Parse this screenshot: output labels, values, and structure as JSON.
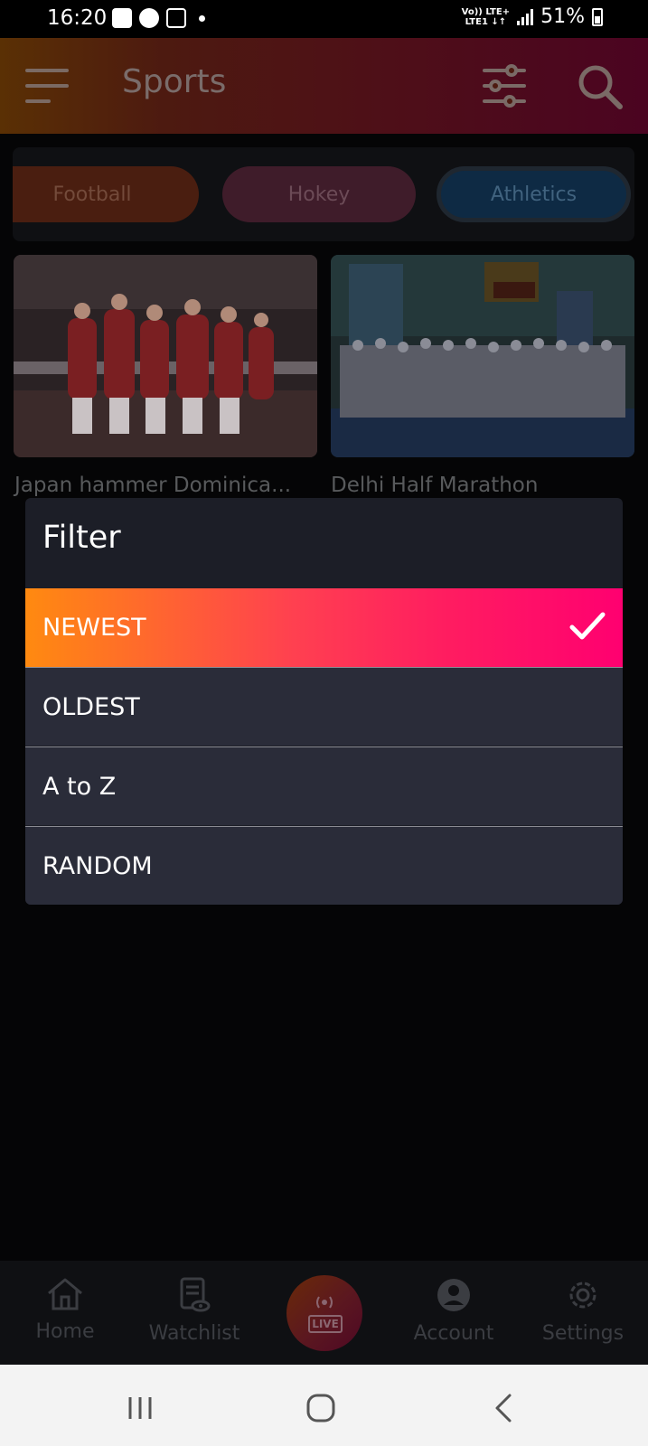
{
  "status_bar": {
    "time": "16:20",
    "network_line1": "Vo)) LTE+",
    "network_line2": "LTE1 ↓↑",
    "battery": "51%"
  },
  "app_bar": {
    "title": "Sports",
    "menu_icon": "hamburger-menu-icon",
    "filter_icon": "sliders-icon",
    "search_icon": "search-icon"
  },
  "categories": [
    {
      "label": "Football"
    },
    {
      "label": "Hokey"
    },
    {
      "label": "Athletics"
    }
  ],
  "news": [
    {
      "title": "Japan hammer Dominica...",
      "image": "volleyball-team-photo"
    },
    {
      "title": "Delhi Half Marathon",
      "image": "marathon-start-photo"
    }
  ],
  "filter_dialog": {
    "title": "Filter",
    "options": [
      {
        "label": "NEWEST",
        "selected": true
      },
      {
        "label": "OLDEST",
        "selected": false
      },
      {
        "label": "A to Z",
        "selected": false
      },
      {
        "label": "RANDOM",
        "selected": false
      }
    ]
  },
  "bottom_nav": {
    "items": [
      {
        "label": "Home",
        "icon": "home-icon"
      },
      {
        "label": "Watchlist",
        "icon": "watchlist-icon"
      },
      {
        "label": "LIVE",
        "icon": "live-broadcast-icon"
      },
      {
        "label": "Account",
        "icon": "account-icon"
      },
      {
        "label": "Settings",
        "icon": "gear-icon"
      }
    ]
  },
  "colors": {
    "accent_start": "#ff8a10",
    "accent_end": "#ff0070",
    "dialog_bg": "#1c1e27",
    "option_bg": "#2a2c39"
  }
}
